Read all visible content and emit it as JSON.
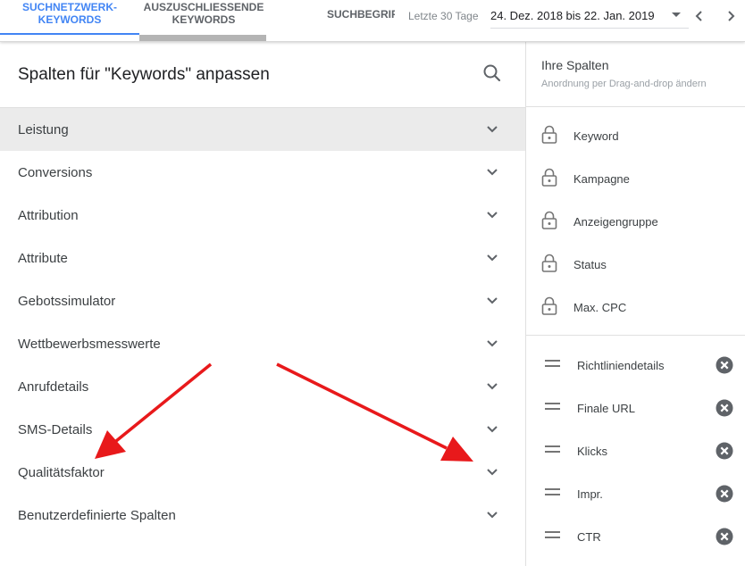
{
  "tabs": [
    {
      "line1": "Suchnetzwerk-",
      "line2": "Keywords"
    },
    {
      "line1": "Auszuschliessende",
      "line2": "Keywords"
    },
    {
      "line1": "Suchbegriff",
      "line2": ""
    }
  ],
  "date": {
    "preset_label": "Letzte 30 Tage",
    "range": "24. Dez. 2018 bis 22. Jan. 2019"
  },
  "left_panel": {
    "title": "Spalten für \"Keywords\" anpassen",
    "categories": [
      {
        "label": "Leistung"
      },
      {
        "label": "Conversions"
      },
      {
        "label": "Attribution"
      },
      {
        "label": "Attribute"
      },
      {
        "label": "Gebotssimulator"
      },
      {
        "label": "Wettbewerbsmesswerte"
      },
      {
        "label": "Anrufdetails"
      },
      {
        "label": "SMS-Details"
      },
      {
        "label": "Qualitätsfaktor"
      },
      {
        "label": "Benutzerdefinierte Spalten"
      }
    ]
  },
  "right_panel": {
    "title": "Ihre Spalten",
    "subtitle": "Anordnung per Drag-and-drop ändern",
    "locked_columns": [
      {
        "label": "Keyword"
      },
      {
        "label": "Kampagne"
      },
      {
        "label": "Anzeigengruppe"
      },
      {
        "label": "Status"
      },
      {
        "label": "Max. CPC"
      }
    ],
    "movable_columns": [
      {
        "label": "Richtliniendetails"
      },
      {
        "label": "Finale URL"
      },
      {
        "label": "Klicks"
      },
      {
        "label": "Impr."
      },
      {
        "label": "CTR"
      }
    ]
  },
  "colors": {
    "accent": "#4285f4",
    "active_row": "#ebebeb",
    "annotation_arrow": "#e8191b",
    "icon_gray": "#5f6368"
  },
  "icons": {
    "search": "search-icon",
    "chevron": "chevron-down-icon",
    "lock": "lock-icon",
    "drag": "drag-handle-icon",
    "remove": "remove-circle-icon"
  }
}
